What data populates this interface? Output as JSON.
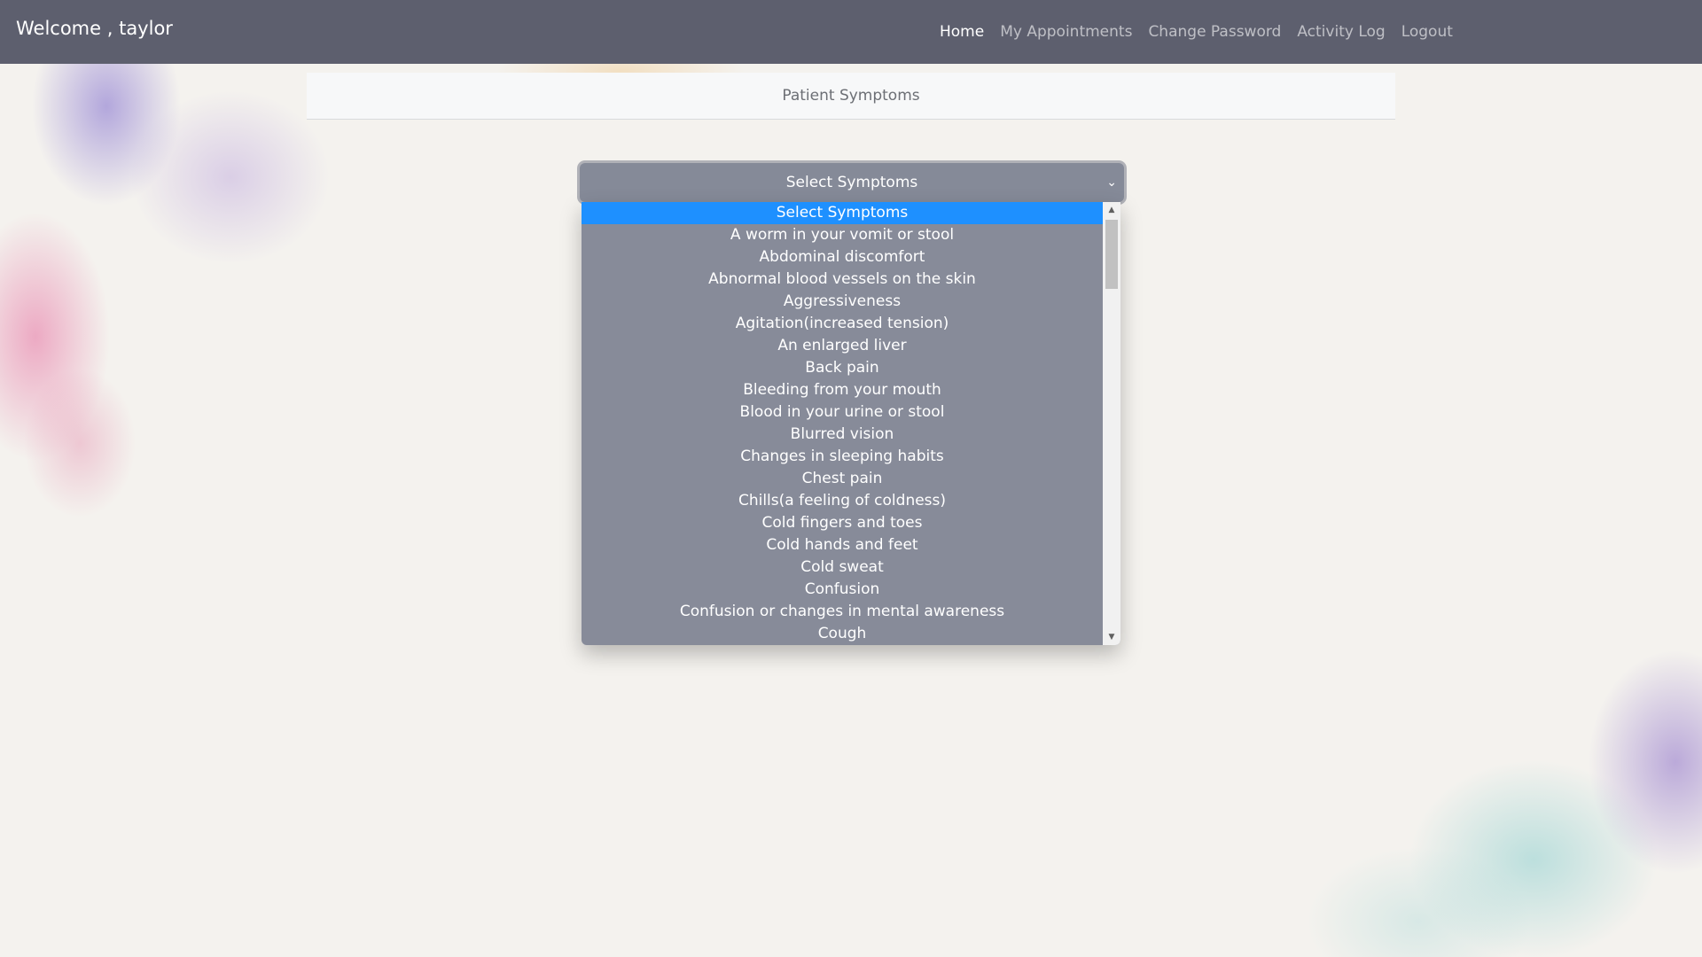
{
  "navbar": {
    "brand": "Welcome , taylor",
    "links": [
      "Home",
      "My Appointments",
      "Change Password",
      "Activity Log",
      "Logout"
    ]
  },
  "card": {
    "header": "Patient Symptoms"
  },
  "symptom_select": {
    "selected": "Select Symptoms",
    "options": [
      "Select Symptoms",
      "A worm in your vomit or stool",
      "Abdominal discomfort",
      "Abnormal blood vessels on the skin",
      "Aggressiveness",
      "Agitation(increased tension)",
      "An enlarged liver",
      "Back pain",
      "Bleeding from your mouth",
      "Blood in your urine or stool",
      "Blurred vision",
      "Changes in sleeping habits",
      "Chest pain",
      "Chills(a feeling of coldness)",
      "Cold fingers and toes",
      "Cold hands and feet",
      "Cold sweat",
      "Confusion",
      "Confusion or changes in mental awareness",
      "Cough"
    ]
  },
  "colors": {
    "navbar": "#5d5f6e",
    "select_bg": "#858a98",
    "option_highlight": "#1e90ff"
  },
  "icons": {
    "select_chevron": "chevron-down-icon",
    "scroll_up": "scroll-up-arrow-icon",
    "scroll_down": "scroll-down-arrow-icon"
  }
}
